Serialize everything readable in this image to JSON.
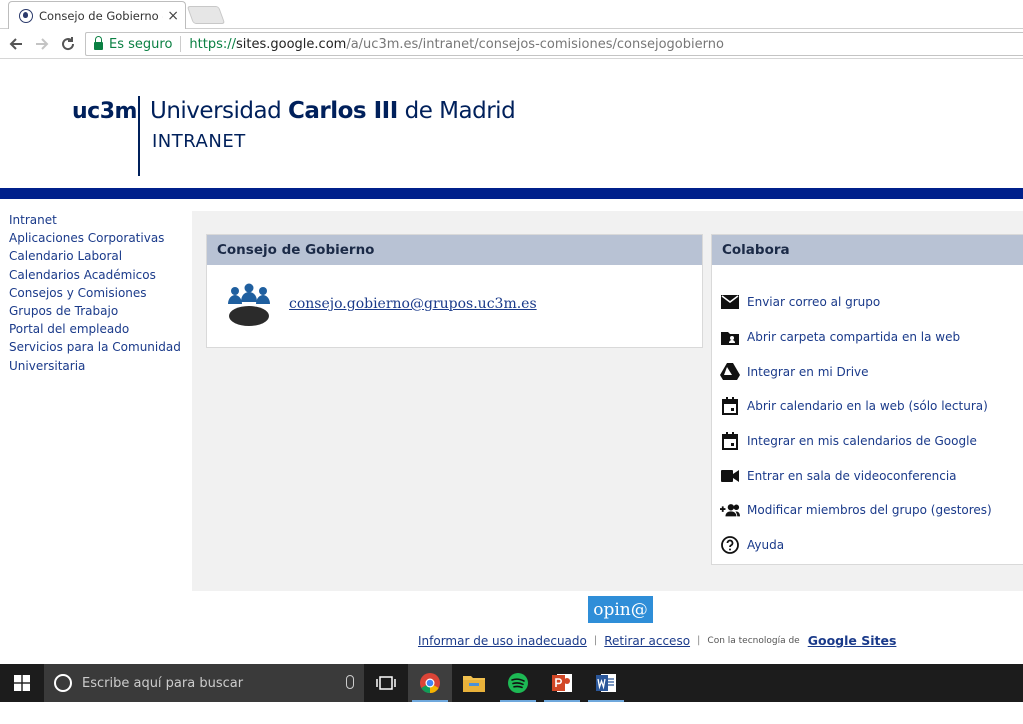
{
  "browser": {
    "tab_title": "Consejo de Gobierno - In",
    "tab_close": "×",
    "secure_label": "Es seguro",
    "url_scheme": "https://",
    "url_host": "sites.google.com",
    "url_path": "/a/uc3m.es/intranet/consejos-comisiones/consejogobierno"
  },
  "header": {
    "logo_short": "uc3m",
    "logo_name_pre": "Universidad ",
    "logo_name_bold": "Carlos III",
    "logo_name_post": " de Madrid",
    "logo_sub": "INTRANET",
    "brand_color": "#00205b"
  },
  "sidebar": {
    "items": [
      {
        "label": "Intranet"
      },
      {
        "label": "Aplicaciones Corporativas"
      },
      {
        "label": "Calendario Laboral"
      },
      {
        "label": "Calendarios Académicos"
      },
      {
        "label": "Consejos y Comisiones"
      },
      {
        "label": "Grupos de Trabajo"
      },
      {
        "label": "Portal del empleado"
      },
      {
        "label": "Servicios para la Comunidad Universitaria"
      }
    ]
  },
  "main": {
    "group_panel": {
      "title": "Consejo de Gobierno",
      "email": "consejo.gobierno@grupos.uc3m.es",
      "icon": "people-group-icon"
    },
    "colabora_panel": {
      "title": "Colabora",
      "items": [
        {
          "label": "Enviar correo al grupo",
          "icon": "mail-icon"
        },
        {
          "label": "Abrir carpeta compartida en la web",
          "icon": "shared-folder-icon"
        },
        {
          "label": "Integrar en mi Drive",
          "icon": "drive-icon"
        },
        {
          "label": "Abrir calendario en la web (sólo lectura)",
          "icon": "calendar-icon"
        },
        {
          "label": "Integrar en mis calendarios de Google",
          "icon": "calendar-add-icon"
        },
        {
          "label": "Entrar en sala de videoconferencia",
          "icon": "video-icon"
        },
        {
          "label": "Modificar miembros del grupo (gestores)",
          "icon": "add-user-icon"
        },
        {
          "label": "Ayuda",
          "icon": "help-icon"
        }
      ]
    }
  },
  "footer": {
    "opina": "opin@",
    "report": "Informar de uso inadecuado",
    "remove_access": "Retirar acceso",
    "powered_by": "Con la tecnología de",
    "google_sites": "Google Sites"
  },
  "taskbar": {
    "search_placeholder": "Escribe aquí para buscar"
  }
}
